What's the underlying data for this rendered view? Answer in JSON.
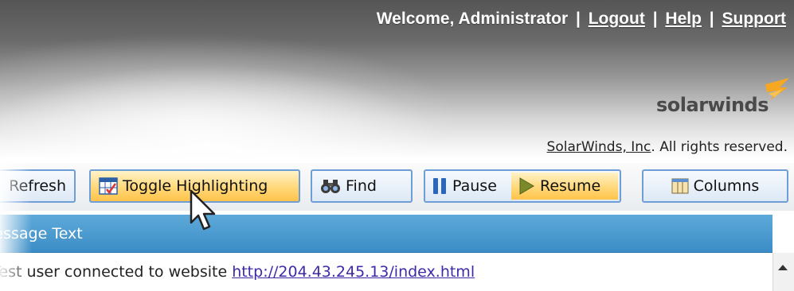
{
  "header": {
    "welcome_text": "Welcome, Administrator",
    "separator": "|",
    "logout_label": "Logout",
    "help_label": "Help",
    "support_label": "Support",
    "logo_text": "solarwinds",
    "copyright_company": "SolarWinds, Inc",
    "copyright_rest": ". All rights reserved."
  },
  "toolbar": {
    "refresh_label": "Refresh",
    "toggle_highlighting_label": "Toggle Highlighting",
    "find_label": "Find",
    "pause_label": "Pause",
    "resume_label": "Resume",
    "columns_label": "Columns"
  },
  "table": {
    "columns": [
      "Message Text"
    ],
    "rows": [
      {
        "message_prefix": "Test user connected to website",
        "link": "http://204.43.245.13/index.html"
      }
    ]
  },
  "colors": {
    "accent_blue": "#3b8dc7",
    "highlight_orange": "#ffc44a",
    "logo_orange": "#f7a823",
    "link_purple": "#3c2aa8"
  },
  "icons": [
    "toggle-highlighting-icon",
    "binoculars-icon",
    "pause-icon",
    "play-icon",
    "columns-icon",
    "solarwinds-logo-icon",
    "scroll-up-arrow-icon",
    "mouse-cursor"
  ]
}
